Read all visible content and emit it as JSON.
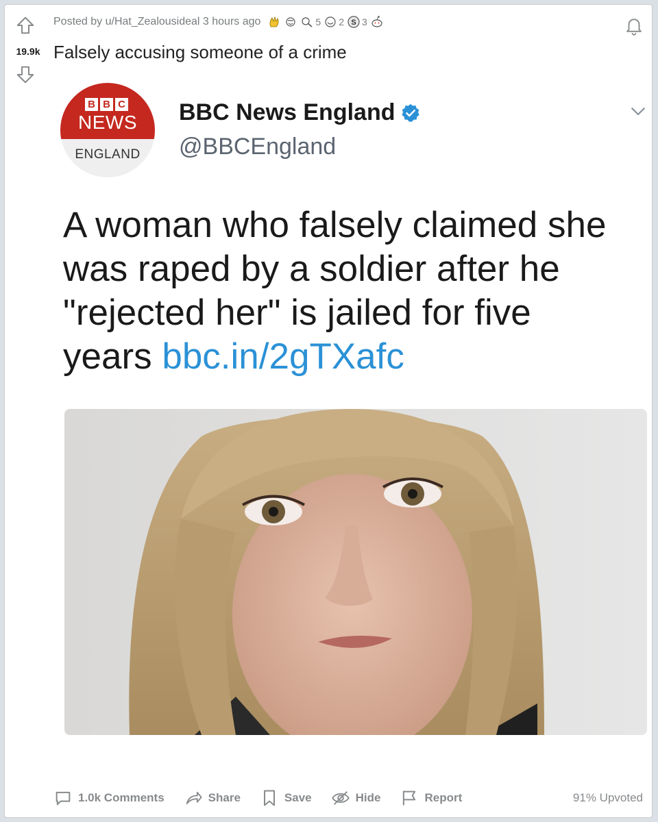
{
  "vote": {
    "score": "19.9k",
    "up_icon": "arrow-up-icon",
    "down_icon": "arrow-down-icon"
  },
  "meta": {
    "posted_by": "Posted by u/Hat_Zealousideal 3 hours ago",
    "awards": [
      {
        "icon": "clapping-hands-award-icon",
        "count": ""
      },
      {
        "icon": "wholesome-award-icon",
        "count": ""
      },
      {
        "icon": "helpful-award-icon",
        "count": "5"
      },
      {
        "icon": "smile-award-icon",
        "count": "2"
      },
      {
        "icon": "silver-coin-award-icon",
        "count": "3"
      },
      {
        "icon": "snoo-award-icon",
        "count": ""
      }
    ]
  },
  "post": {
    "title": "Falsely accusing someone of a crime"
  },
  "tweet": {
    "logo": {
      "letters": [
        "B",
        "B",
        "C"
      ],
      "brand": "NEWS",
      "region": "ENGLAND",
      "color": "#c4281f"
    },
    "name": "BBC News England",
    "handle": "@BBCEngland",
    "text": "A woman who falsely claimed she was raped by a soldier after he \"rejected her\" is jailed for five years",
    "link": "bbc.in/2gTXafc",
    "link_color": "#2b91d6"
  },
  "actions": {
    "comments": "1.0k Comments",
    "share": "Share",
    "save": "Save",
    "hide": "Hide",
    "report": "Report",
    "upvoted": "91% Upvoted"
  }
}
